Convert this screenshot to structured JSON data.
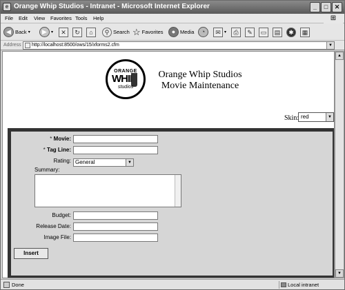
{
  "window": {
    "title": "Orange Whip Studios - Intranet - Microsoft Internet Explorer",
    "controls": {
      "minimize": "_",
      "maximize": "□",
      "close": "✕"
    }
  },
  "menu": [
    "File",
    "Edit",
    "View",
    "Favorites",
    "Tools",
    "Help"
  ],
  "toolbar": {
    "back": "Back",
    "search": "Search",
    "favorites": "Favorites",
    "media": "Media"
  },
  "address": {
    "label": "Address",
    "url": "http://localhost:8500/ows/15/xforms2.cfm"
  },
  "page": {
    "logo": {
      "top": "ORANGE",
      "middle": "WHIP",
      "bottom": "studios"
    },
    "heading_line1": "Orange Whip Studios",
    "heading_line2": "Movie Maintenance",
    "skin_label": "Skin:",
    "skin_value": "red"
  },
  "form": {
    "movie_req": "*",
    "movie_label": "Movie:",
    "tagline_req": "*",
    "tagline_label": "Tag Line:",
    "rating_label": "Rating:",
    "rating_value": "General",
    "summary_label": "Summary:",
    "budget_label": "Budget:",
    "release_label": "Release Date:",
    "image_label": "Image File:",
    "insert_label": "Insert"
  },
  "status": {
    "text": "Done",
    "zone": "Local intranet"
  }
}
